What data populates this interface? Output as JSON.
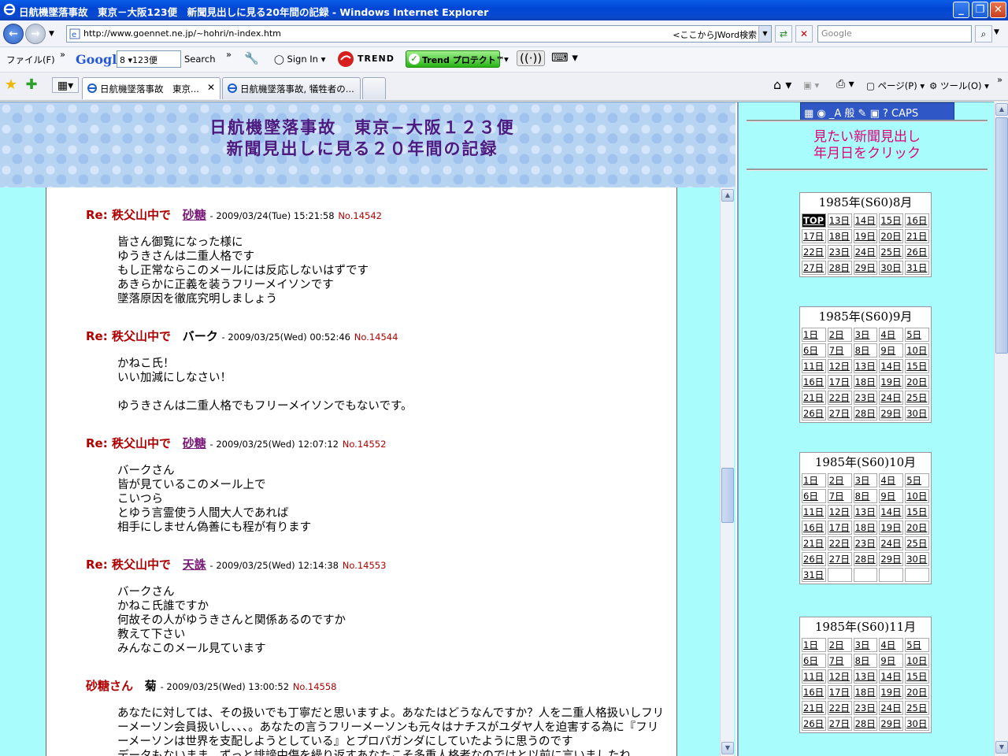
{
  "window": {
    "title": "日航機墜落事故　東京－大阪123便　新聞見出しに見る20年間の記録 - Windows Internet Explorer"
  },
  "address": {
    "url": "http://www.goennet.ne.jp/~hohri/n-index.htm",
    "jword": "<ここからJWord検索",
    "search_placeholder": "Google"
  },
  "toolbar": {
    "file_menu": "ファイル(F)",
    "google": "Google",
    "google_box": "8 ▾123便",
    "search": "Search",
    "more": "»",
    "sign_in": "Sign In",
    "trend": "TREND",
    "trend_protect": "Trend プロテクト™"
  },
  "tabs": [
    {
      "label": "日航機墜落事故　東京..."
    },
    {
      "label": "日航機墜落事故, 犠牲者の..."
    }
  ],
  "command_bar": {
    "page": "ページ(P)",
    "tools": "ツール(O)"
  },
  "banner": {
    "line1": "日航機墜落事故　東京−大阪１２３便",
    "line2": "新聞見出しに見る２０年間の記録"
  },
  "posts": [
    {
      "subject": "Re: 秩父山中で",
      "author": "砂糖",
      "date": "- 2009/03/24(Tue) 15:21:58",
      "no": "No.14542",
      "body": "皆さん御覧になった様に\nゆうきさんは二重人格です\nもし正常ならこのメールには反応しないはずです\nあきらかに正義を装うフリーメイソンです\n墜落原因を徹底究明しましょう"
    },
    {
      "subject": "Re: 秩父山中で",
      "author": "バーク",
      "date": "- 2009/03/25(Wed) 00:52:46",
      "no": "No.14544",
      "body": "かねこ氏！\nいい加減にしなさい！\n\nゆうきさんは二重人格でもフリーメイソンでもないです。"
    },
    {
      "subject": "Re: 秩父山中で",
      "author": "砂糖",
      "date": "- 2009/03/25(Wed) 12:07:12",
      "no": "No.14552",
      "body": "バークさん\n皆が見ているこのメール上で\nこいつら\nとゆう言霊使う人間大人であれば\n相手にしません偽善にも程が有ります"
    },
    {
      "subject": "Re: 秩父山中で",
      "author": "天誅",
      "date": "- 2009/03/25(Wed) 12:14:38",
      "no": "No.14553",
      "body": "バークさん\nかねこ氏誰ですか\n何故その人がゆうきさんと関係あるのですか\n教えて下さい\nみんなこのメール見ています"
    },
    {
      "subject": "砂糖さん",
      "author": "菊",
      "date": "- 2009/03/25(Wed) 13:00:52",
      "no": "No.14558",
      "body": "あなたに対しては、その扱いでも丁寧だと思いますよ。あなたはどうなんですか？人を二重人格扱いしフリーメーソン会員扱いし、、、。あなたの言うフリーメーソンも元々はナチスがユダヤ人を迫害する為に『フリーメーソンは世界を支配しようとしている』とプロパガンダにしていたように思うのです\nデータもないまま、ずっと誹謗中傷を繰り返すあなたこそ多重人格者なのではと以前に言いましたね"
    }
  ],
  "right": {
    "ime": "▦ ◉ _A 般 ✎ ▣ ? CAPS",
    "title1": "見たい新聞見出し",
    "title2": "年月日をクリック",
    "calendars": [
      {
        "title": "1985年(S60)8月",
        "rows": [
          [
            "TOP",
            "13日",
            "14日",
            "15日",
            "16日"
          ],
          [
            "17日",
            "18日",
            "19日",
            "20日",
            "21日"
          ],
          [
            "22日",
            "23日",
            "24日",
            "25日",
            "26日"
          ],
          [
            "27日",
            "28日",
            "29日",
            "30日",
            "31日"
          ]
        ]
      },
      {
        "title": "1985年(S60)9月",
        "rows": [
          [
            "1日",
            "2日",
            "3日",
            "4日",
            "5日"
          ],
          [
            "6日",
            "7日",
            "8日",
            "9日",
            "10日"
          ],
          [
            "11日",
            "12日",
            "13日",
            "14日",
            "15日"
          ],
          [
            "16日",
            "17日",
            "18日",
            "19日",
            "20日"
          ],
          [
            "21日",
            "22日",
            "23日",
            "24日",
            "25日"
          ],
          [
            "26日",
            "27日",
            "28日",
            "29日",
            "30日"
          ]
        ]
      },
      {
        "title": "1985年(S60)10月",
        "rows": [
          [
            "1日",
            "2日",
            "3日",
            "4日",
            "5日"
          ],
          [
            "6日",
            "7日",
            "8日",
            "9日",
            "10日"
          ],
          [
            "11日",
            "12日",
            "13日",
            "14日",
            "15日"
          ],
          [
            "16日",
            "17日",
            "18日",
            "19日",
            "20日"
          ],
          [
            "21日",
            "22日",
            "23日",
            "24日",
            "25日"
          ],
          [
            "26日",
            "27日",
            "28日",
            "29日",
            "30日"
          ],
          [
            "31日",
            "",
            "",
            "",
            ""
          ]
        ]
      },
      {
        "title": "1985年(S60)11月",
        "rows": [
          [
            "1日",
            "2日",
            "3日",
            "4日",
            "5日"
          ],
          [
            "6日",
            "7日",
            "8日",
            "9日",
            "10日"
          ],
          [
            "11日",
            "12日",
            "13日",
            "14日",
            "15日"
          ],
          [
            "16日",
            "17日",
            "18日",
            "19日",
            "20日"
          ],
          [
            "21日",
            "22日",
            "23日",
            "24日",
            "25日"
          ],
          [
            "26日",
            "27日",
            "28日",
            "29日",
            "30日"
          ]
        ]
      }
    ]
  }
}
